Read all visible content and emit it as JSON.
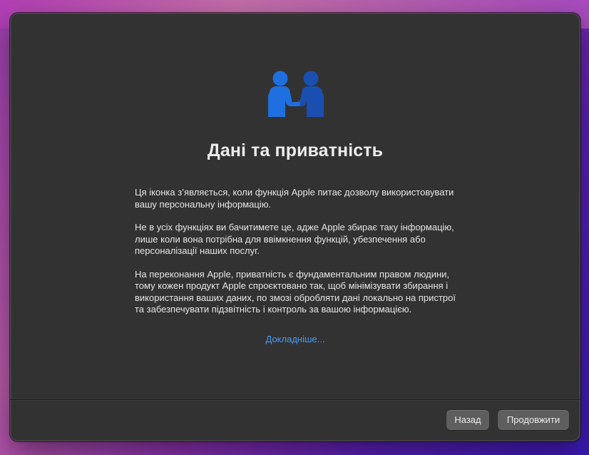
{
  "dialog": {
    "title": "Дані та приватність",
    "paragraphs": [
      "Ця іконка з’являється, коли функція Apple питає дозволу використовувати вашу персональну інформацію.",
      "Не в усіх функціях ви бачитимете це, адже Apple збирає таку інформацію, лише коли вона потрібна для ввімкнення функцій, убезпечення або персоналізації наших послуг.",
      "На переконання Apple, приватність є фундаментальним правом людини, тому кожен продукт Apple спроєктовано так, щоб мінімізувати збирання і використання ваших даних, по змозі обробляти дані локально на пристрої та забезпечувати підзвітність і контроль за вашою інформацією."
    ],
    "learn_more": "Докладніше..."
  },
  "buttons": {
    "back": "Назад",
    "continue": "Продовжити"
  },
  "icons": {
    "hero": "privacy-handshake-icon"
  },
  "colors": {
    "window_bg": "#323232",
    "accent_blue": "#1f6fe0",
    "accent_blue_dark": "#1a4fb0",
    "link": "#4a9bf5",
    "button_bg": "#5e5e5e"
  }
}
